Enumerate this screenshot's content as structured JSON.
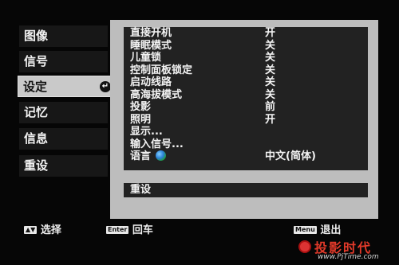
{
  "sidebar": {
    "items": [
      {
        "label": "图像",
        "active": false
      },
      {
        "label": "信号",
        "active": false
      },
      {
        "label": "设定",
        "active": true
      },
      {
        "label": "记忆",
        "active": false
      },
      {
        "label": "信息",
        "active": false
      },
      {
        "label": "重设",
        "active": false
      }
    ],
    "enter_icon": "↵"
  },
  "settings": {
    "rows": [
      {
        "label": "直接开机",
        "value": "开"
      },
      {
        "label": "睡眠模式",
        "value": "关"
      },
      {
        "label": "儿童锁",
        "value": "关"
      },
      {
        "label": "控制面板锁定",
        "value": "关"
      },
      {
        "label": "启动线路",
        "value": "关"
      },
      {
        "label": "高海拔模式",
        "value": "关"
      },
      {
        "label": "投影",
        "value": "前"
      },
      {
        "label": "照明",
        "value": "开"
      },
      {
        "label": "显示...",
        "value": ""
      },
      {
        "label": "输入信号...",
        "value": ""
      },
      {
        "label": "语言",
        "value": "中文(简体)",
        "icon": "globe-icon"
      }
    ],
    "reset_label": "重设"
  },
  "footer": {
    "select_key": "▲▼",
    "select_label": "选择",
    "enter_key": "Enter",
    "enter_label": "回车",
    "menu_key": "Menu",
    "menu_label": "退出"
  },
  "watermark": {
    "title": "投影时代",
    "url": "www.PjTime.com"
  },
  "colors": {
    "accent_watermark": "#e23a2a",
    "panel_bg": "#bdbdbd",
    "list_bg": "#222222"
  }
}
